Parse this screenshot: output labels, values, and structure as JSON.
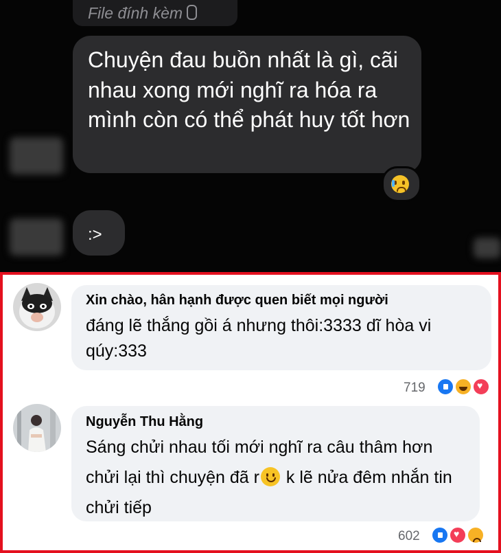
{
  "chat": {
    "attachment_label": "File đính kèm",
    "message": "Chuyện đau buồn nhất là gì, cãi nhau xong mới nghĩ ra hóa ra mình còn có thể phát huy tốt hơn",
    "reply": ":>",
    "reaction_icon": "crying-face-emoji"
  },
  "comments": [
    {
      "name": "Xin chào, hân hạnh được quen biết mọi người",
      "text": "đáng lẽ thắng gồi á nhưng thôi:3333 dĩ hòa vi qúy:333",
      "reaction_count": "719",
      "reactions": [
        "like",
        "haha",
        "love"
      ]
    },
    {
      "name": "Nguyễn Thu Hằng",
      "text_before_emoji": "Sáng chửi nhau tối mới nghĩ ra câu thâm hơn chửi lại thì chuyện đã r",
      "text_after_emoji": " k lẽ nửa đêm nhắn tin chửi tiếp",
      "reaction_count": "602",
      "reactions": [
        "like",
        "love",
        "sad"
      ]
    }
  ],
  "colors": {
    "frame": "#e4101f",
    "comment_bubble": "#f0f2f5",
    "chat_bubble": "#2c2c2e"
  }
}
